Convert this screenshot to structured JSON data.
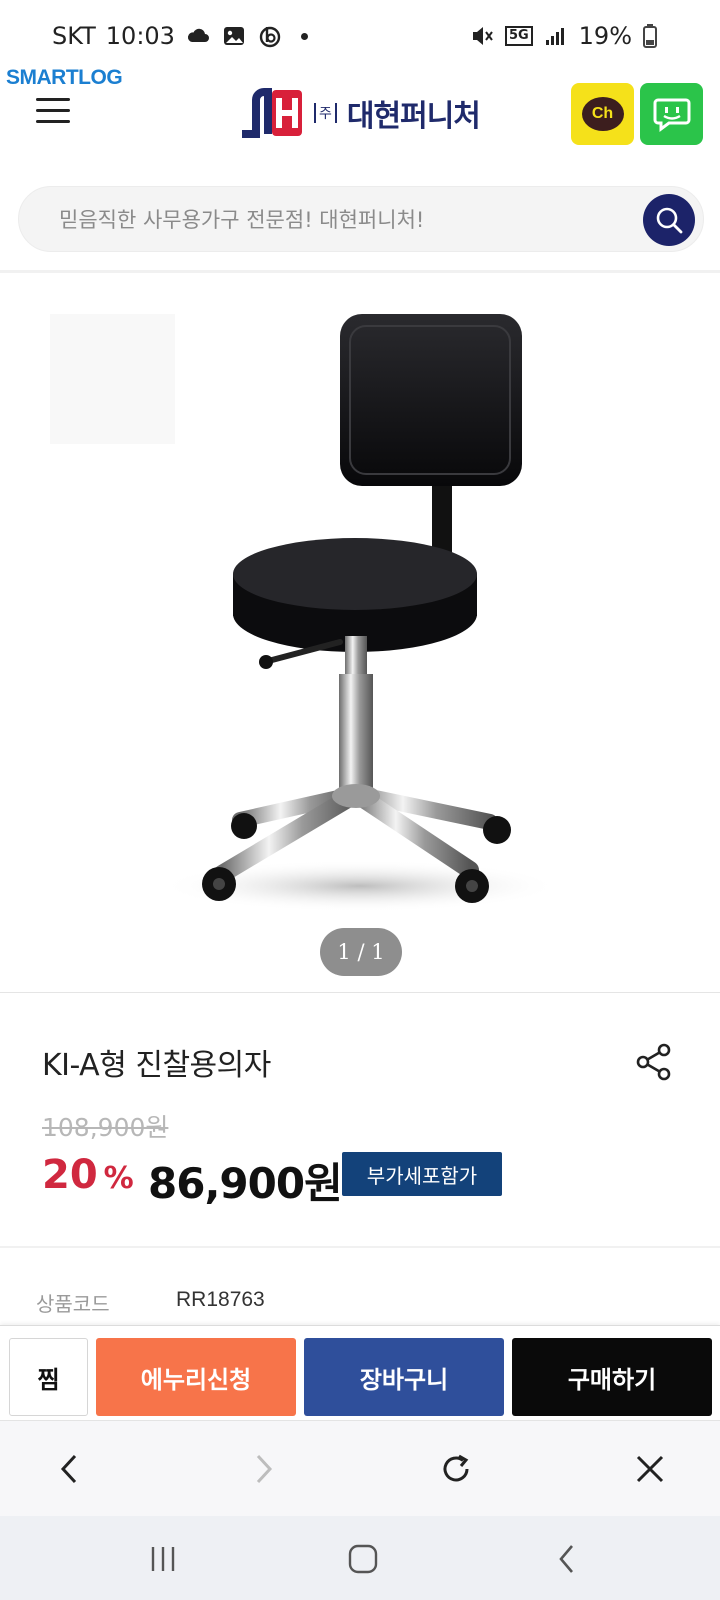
{
  "status_bar": {
    "carrier": "SKT",
    "time": "10:03",
    "battery": "19%",
    "network": "5G",
    "icons": [
      "cloud-icon",
      "gallery-icon",
      "b-app-icon",
      "mute-icon",
      "signal-icon",
      "battery-icon"
    ]
  },
  "header": {
    "smartlog": "SMARTLOG",
    "logo_corp": "주",
    "logo_text": "대현퍼니처",
    "kakao_label": "Ch",
    "icons": [
      "menu-icon",
      "kakao-channel-icon",
      "talk-icon"
    ]
  },
  "search": {
    "placeholder": "믿음직한 사무용가구 전문점! 대현퍼니처!",
    "icon": "search-icon"
  },
  "gallery": {
    "pager": "1 / 1"
  },
  "product": {
    "title": "KI-A형 진찰용의자",
    "original_price": "108,900원",
    "discount_value": "20",
    "discount_unit": "%",
    "sale_price": "86,900원",
    "vat_badge": "부가세포함가",
    "code_label": "상품코드",
    "code_value": "RR18763"
  },
  "actions": {
    "wish": "찜",
    "enuri": "에누리신청",
    "cart": "장바구니",
    "buy": "구매하기"
  },
  "colors": {
    "navy": "#1c2369",
    "discount_red": "#d0283f",
    "enuri_orange": "#f7744a",
    "cart_blue": "#2f4f9b",
    "buy_black": "#0a0a0a",
    "vat_badge_blue": "#13427a",
    "kakao_yellow": "#f5e11a",
    "talk_green": "#2bc44a"
  }
}
